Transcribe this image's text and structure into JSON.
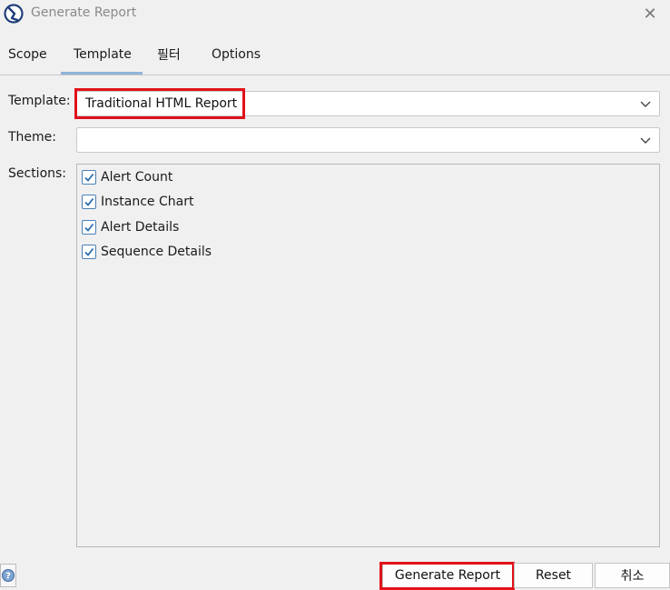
{
  "window": {
    "title": "Generate Report",
    "close_glyph": "✕",
    "icon": "app-logo-icon"
  },
  "tabs": [
    {
      "label": "Scope",
      "active": false
    },
    {
      "label": "Template",
      "active": true
    },
    {
      "label": "필터",
      "active": false
    },
    {
      "label": "Options",
      "active": false
    }
  ],
  "form": {
    "template_label": "Template:",
    "template_value": "Traditional HTML Report",
    "theme_label": "Theme:",
    "theme_value": "",
    "sections_label": "Sections:",
    "sections": [
      {
        "label": "Alert Count",
        "checked": true
      },
      {
        "label": "Instance Chart",
        "checked": true
      },
      {
        "label": "Alert Details",
        "checked": true
      },
      {
        "label": "Sequence Details",
        "checked": true
      }
    ]
  },
  "buttons": {
    "help_icon": "help-question-icon",
    "generate": "Generate Report",
    "reset": "Reset",
    "cancel": "취소"
  },
  "colors": {
    "highlight": "#e0121a",
    "tab_underline": "#8fb4d9",
    "checkbox_check": "#2b6cb0"
  }
}
